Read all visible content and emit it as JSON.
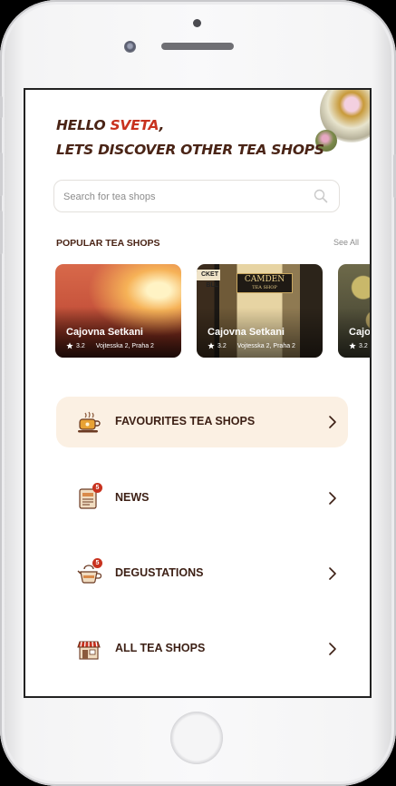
{
  "greeting": {
    "hello": "HELLO ",
    "user_name": "SVETA",
    "comma": ",",
    "line2": "LETS DISCOVER OTHER TEA SHOPS"
  },
  "search": {
    "placeholder": "Search for tea shops",
    "icon": "search-icon"
  },
  "popular": {
    "title": "POPULAR TEA SHOPS",
    "see_all": "See All",
    "cards": [
      {
        "name": "Cajovna Setkani",
        "rating": "3.2",
        "address": "Vojtesska 2, Praha 2"
      },
      {
        "name": "Cajovna Setkani",
        "rating": "3.2",
        "address": "Vojtesska 2, Praha 2",
        "sign": "CAMDEN",
        "sign_sub": "TEA SHOP",
        "left_sign": "CKET BLL"
      },
      {
        "name": "Cajo",
        "rating": "3.2"
      }
    ]
  },
  "menu": [
    {
      "label": "FAVOURITES TEA SHOPS",
      "icon": "tea-cup-icon",
      "active": true
    },
    {
      "label": "NEWS",
      "icon": "newspaper-icon",
      "badge": "5"
    },
    {
      "label": "DEGUSTATIONS",
      "icon": "teapot-icon",
      "badge": "5"
    },
    {
      "label": "ALL TEA SHOPS",
      "icon": "shop-icon"
    }
  ],
  "colors": {
    "accent_red": "#c8321f",
    "dark_brown": "#4a2416",
    "active_bg": "#fbf0e3"
  }
}
